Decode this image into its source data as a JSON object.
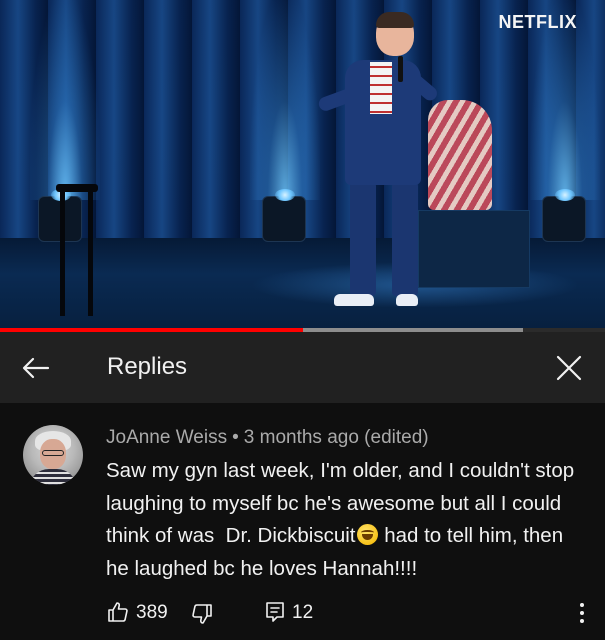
{
  "video": {
    "brand_logo": "NETFLIX",
    "progress_played": 0.5,
    "progress_buffered": 0.865,
    "colors": {
      "played": "#ff0000",
      "buffered": "#8d8d8d",
      "track": "#2b2b2b"
    }
  },
  "replies_header": {
    "title": "Replies",
    "back_icon": "arrow-left-icon",
    "close_icon": "close-icon"
  },
  "comment": {
    "author": "JoAnne Weiss",
    "separator": "•",
    "time": "3 months ago (edited)",
    "text_before_emoji": "Saw my gyn last week, I'm older, and I couldn't stop laughing to myself bc he's awesome but all I could think of was  Dr. Dickbiscuit",
    "emoji": "grinning-squinting-face",
    "text_after_emoji": " had to tell him, then he laughed bc he loves Hannah!!!!",
    "likes": "389",
    "replies": "12",
    "icons": {
      "like": "thumbs-up-icon",
      "dislike": "thumbs-down-icon",
      "reply": "reply-comment-icon",
      "more": "more-vertical-icon"
    }
  }
}
